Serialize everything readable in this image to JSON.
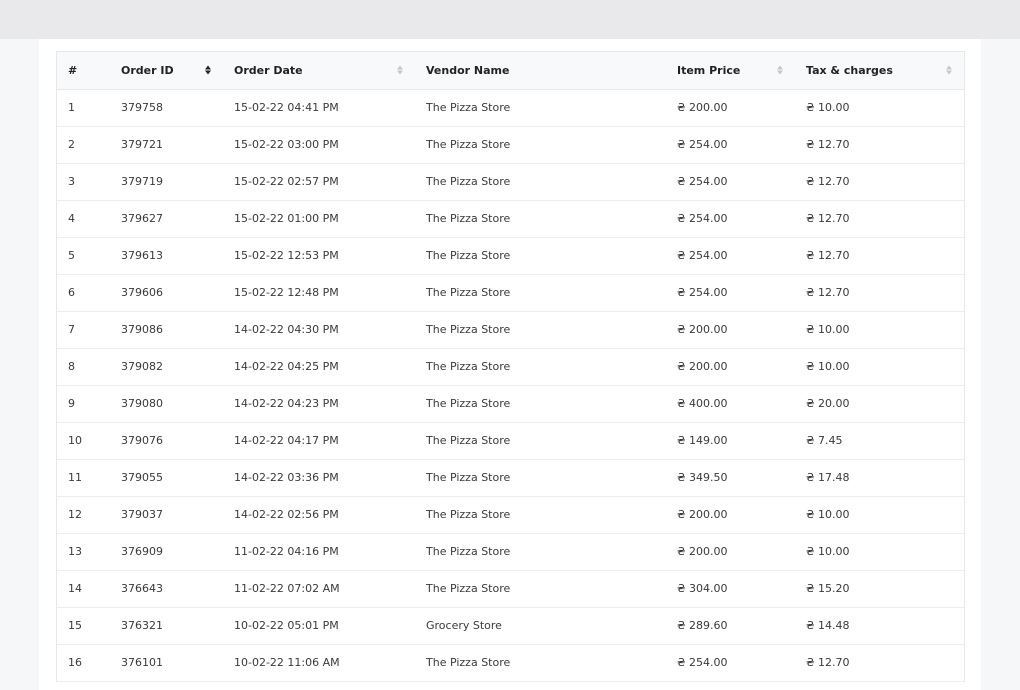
{
  "table": {
    "headers": {
      "num": "#",
      "order_id": "Order ID",
      "order_date": "Order Date",
      "vendor_name": "Vendor Name",
      "item_price": "Item Price",
      "tax_charges": "Tax & charges"
    },
    "sort": {
      "column": "order_id",
      "direction": "ascending"
    },
    "rows": [
      {
        "num": "1",
        "order_id": "379758",
        "order_date": "15-02-22 04:41 PM",
        "vendor": "The Pizza Store",
        "price": "₴ 200.00",
        "tax": "₴ 10.00"
      },
      {
        "num": "2",
        "order_id": "379721",
        "order_date": "15-02-22 03:00 PM",
        "vendor": "The Pizza Store",
        "price": "₴ 254.00",
        "tax": "₴ 12.70"
      },
      {
        "num": "3",
        "order_id": "379719",
        "order_date": "15-02-22 02:57 PM",
        "vendor": "The Pizza Store",
        "price": "₴ 254.00",
        "tax": "₴ 12.70"
      },
      {
        "num": "4",
        "order_id": "379627",
        "order_date": "15-02-22 01:00 PM",
        "vendor": "The Pizza Store",
        "price": "₴ 254.00",
        "tax": "₴ 12.70"
      },
      {
        "num": "5",
        "order_id": "379613",
        "order_date": "15-02-22 12:53 PM",
        "vendor": "The Pizza Store",
        "price": "₴ 254.00",
        "tax": "₴ 12.70"
      },
      {
        "num": "6",
        "order_id": "379606",
        "order_date": "15-02-22 12:48 PM",
        "vendor": "The Pizza Store",
        "price": "₴ 254.00",
        "tax": "₴ 12.70"
      },
      {
        "num": "7",
        "order_id": "379086",
        "order_date": "14-02-22 04:30 PM",
        "vendor": "The Pizza Store",
        "price": "₴ 200.00",
        "tax": "₴ 10.00"
      },
      {
        "num": "8",
        "order_id": "379082",
        "order_date": "14-02-22 04:25 PM",
        "vendor": "The Pizza Store",
        "price": "₴ 200.00",
        "tax": "₴ 10.00"
      },
      {
        "num": "9",
        "order_id": "379080",
        "order_date": "14-02-22 04:23 PM",
        "vendor": "The Pizza Store",
        "price": "₴ 400.00",
        "tax": "₴ 20.00"
      },
      {
        "num": "10",
        "order_id": "379076",
        "order_date": "14-02-22 04:17 PM",
        "vendor": "The Pizza Store",
        "price": "₴ 149.00",
        "tax": "₴ 7.45"
      },
      {
        "num": "11",
        "order_id": "379055",
        "order_date": "14-02-22 03:36 PM",
        "vendor": "The Pizza Store",
        "price": "₴ 349.50",
        "tax": "₴ 17.48"
      },
      {
        "num": "12",
        "order_id": "379037",
        "order_date": "14-02-22 02:56 PM",
        "vendor": "The Pizza Store",
        "price": "₴ 200.00",
        "tax": "₴ 10.00"
      },
      {
        "num": "13",
        "order_id": "376909",
        "order_date": "11-02-22 04:16 PM",
        "vendor": "The Pizza Store",
        "price": "₴ 200.00",
        "tax": "₴ 10.00"
      },
      {
        "num": "14",
        "order_id": "376643",
        "order_date": "11-02-22 07:02 AM",
        "vendor": "The Pizza Store",
        "price": "₴ 304.00",
        "tax": "₴ 15.20"
      },
      {
        "num": "15",
        "order_id": "376321",
        "order_date": "10-02-22 05:01 PM",
        "vendor": "Grocery Store",
        "price": "₴ 289.60",
        "tax": "₴ 14.48"
      },
      {
        "num": "16",
        "order_id": "376101",
        "order_date": "10-02-22 11:06 AM",
        "vendor": "The Pizza Store",
        "price": "₴ 254.00",
        "tax": "₴ 12.70"
      }
    ]
  },
  "colors": {
    "page_bg": "#f6f7f9",
    "topbar": "#e9e9eb",
    "header_bg": "#f8f9fa",
    "border": "#e6e8eb"
  },
  "icons": {
    "sort_active": "sort-ascending-icon",
    "sort_inactive": "sort-icon"
  }
}
